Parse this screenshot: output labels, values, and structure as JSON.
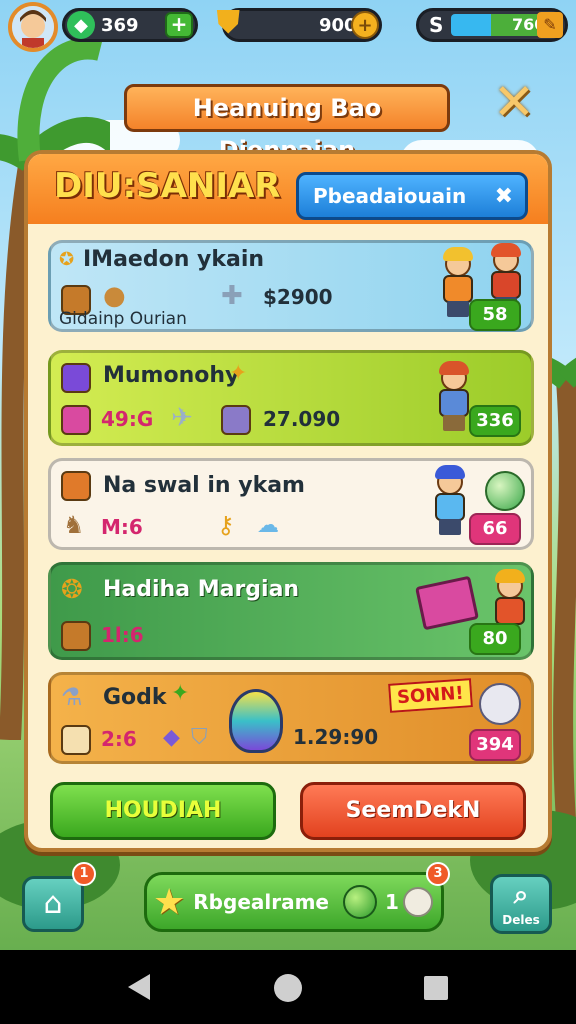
{
  "hud": {
    "gems": "369",
    "coins": "900",
    "cash": "760",
    "cash_symbol": "S"
  },
  "title": "Heanuing Bao Dienpaian",
  "panel": {
    "title": "DIU:SANIAR",
    "search_tab": "Pbeadaiouain"
  },
  "rows": [
    {
      "title": "IMaedon ykain",
      "subtitle": "Gidainp Ourian",
      "value": "$2900",
      "badge": "58",
      "color": "#bfe6f6",
      "badge_color": "#3aa81e"
    },
    {
      "title": "Mumonohy",
      "count": "49:G",
      "value": "27.090",
      "badge": "336",
      "color": "#b9df3a",
      "badge_color": "#3aa81e"
    },
    {
      "title": "Na swal in ykam",
      "count": "M:6",
      "badge": "66",
      "color": "#fbf4e8",
      "badge_color": "#e0357a"
    },
    {
      "title": "Hadiha Margian",
      "count": "1l:6",
      "badge": "80",
      "color": "#52a85c",
      "badge_color": "#3aa81e"
    },
    {
      "title": "Godk",
      "count": "2:6",
      "value": "1.29:90",
      "sale": "SONN!",
      "badge": "394",
      "color": "#e9a13a",
      "badge_color": "#e0357a"
    }
  ],
  "buttons": {
    "left": "HOUDIAH",
    "right": "SeemDekN"
  },
  "bottom": {
    "home_badge": "1",
    "pill_label": "Rbgealrame",
    "pill_count": "1",
    "pill_badge": "3",
    "right_label": "Deles"
  }
}
